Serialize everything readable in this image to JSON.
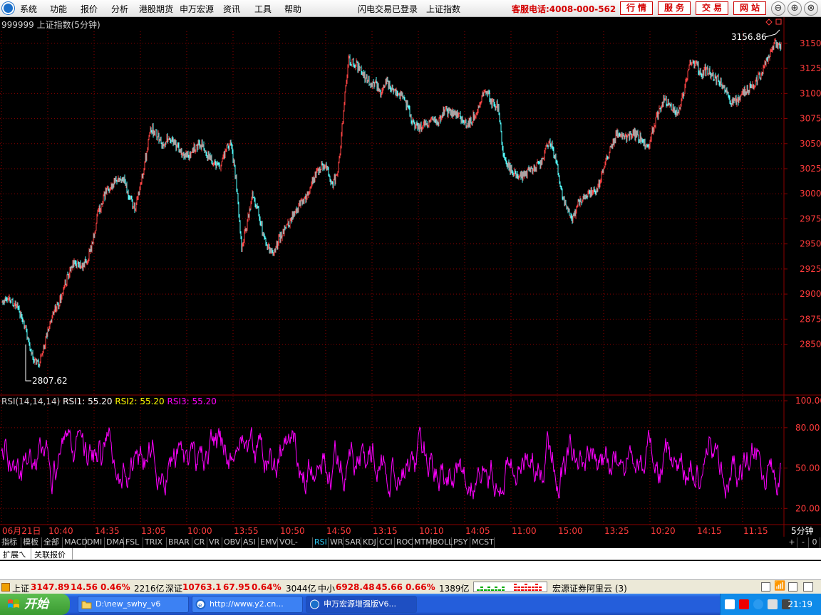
{
  "menubar": {
    "items": [
      "系统",
      "功能",
      "报价",
      "分析",
      "港股期货",
      "申万宏源",
      "资讯",
      "工具",
      "帮助"
    ],
    "status": "闪电交易已登录",
    "index_name": "上证指数",
    "hotline": "客服电话:4008-000-562",
    "buttons": [
      "行情",
      "服务",
      "交易",
      "网站"
    ],
    "window_controls": [
      "⊖",
      "⊕",
      "⊗"
    ]
  },
  "chart_header": {
    "title": "999999 上证指数(5分钟)"
  },
  "colors": {
    "up_candle": "#ff4444",
    "down_candle": "#54ffff",
    "rsi_line": "#ff00ff",
    "rsi1": "#ffffff",
    "rsi2": "#ffff00",
    "rsi3": "#ff00ff",
    "grid": "#8b0000",
    "axis_text": "#ff3b3b"
  },
  "chart_data": [
    {
      "type": "line",
      "series": [
        {
          "values": [
            2890,
            2898,
            2893,
            2885,
            2875,
            2855,
            2835,
            2830,
            2848,
            2870,
            2885,
            2895,
            2912,
            2925,
            2932,
            2926,
            2934,
            2950,
            2978,
            2995,
            3005,
            3010,
            3015,
            3012,
            2995,
            2985,
            3010,
            3035,
            3065,
            3060,
            3050,
            3055,
            3052,
            3046,
            3040,
            3038,
            3045,
            3050,
            3046,
            3035,
            3030,
            3025,
            3045,
            3050,
            3010,
            2945,
            2970,
            2998,
            2985,
            2960,
            2945,
            2940,
            2955,
            2965,
            2970,
            2985,
            2990,
            2995,
            3010,
            3020,
            3030,
            3025,
            3010,
            3020,
            3080,
            3135,
            3130,
            3125,
            3118,
            3110,
            3112,
            3100,
            3112,
            3105,
            3102,
            3098,
            3088,
            3070,
            3065,
            3070,
            3068,
            3075,
            3072,
            3085,
            3080,
            3080,
            3075,
            3070,
            3072,
            3085,
            3097,
            3100,
            3090,
            3088,
            3035,
            3028,
            3020,
            3015,
            3020,
            3025,
            3027,
            3030,
            3045,
            3050,
            3030,
            3000,
            2985,
            2975,
            2990,
            2995,
            3000,
            3002,
            3010,
            3030,
            3045,
            3058,
            3060,
            3055,
            3060,
            3058,
            3055,
            3045,
            3065,
            3080,
            3095,
            3090,
            3080,
            3085,
            3105,
            3132,
            3130,
            3120,
            3125,
            3118,
            3115,
            3110,
            3098,
            3090,
            3095,
            3102,
            3105,
            3110,
            3118,
            3130,
            3140,
            3152,
            3148
          ],
          "min_label": 2807.62,
          "max_label": 3156.86
        }
      ],
      "y_ticks": [
        3150,
        3125,
        3100,
        3075,
        3050,
        3025,
        3000,
        2975,
        2950,
        2925,
        2900,
        2875,
        2850
      ],
      "ylim": [
        2800,
        3162
      ],
      "x_tick_labels": [
        "06月21日",
        "10:40",
        "14:35",
        "13:05",
        "10:00",
        "13:55",
        "10:50",
        "14:50",
        "13:15",
        "10:10",
        "14:05",
        "11:00",
        "15:00",
        "13:25",
        "10:20",
        "14:15",
        "11:15"
      ]
    },
    {
      "type": "line",
      "title": "RSI(14,14,14)",
      "series": [
        {
          "name": "RSI1",
          "value": 55.2
        },
        {
          "name": "RSI2",
          "value": 55.2
        },
        {
          "name": "RSI3",
          "value": 55.2
        }
      ],
      "y_ticks": [
        100.0,
        80.0,
        50.0,
        20.0
      ],
      "ylim": [
        8,
        100
      ],
      "period_label": "5分钟"
    }
  ],
  "tabs": {
    "items": [
      "指标",
      "模板",
      "全部",
      "MACD",
      "DMI",
      "DMA",
      "FSL",
      "TRIX",
      "BRAR",
      "CR",
      "VR",
      "OBV",
      "ASI",
      "EMV",
      "VOL-TDX",
      "RSI",
      "WR",
      "SAR",
      "KDJ",
      "CCI",
      "ROC",
      "MTM",
      "BOLL",
      "PSY",
      "MCST"
    ],
    "active": "RSI",
    "controls": [
      "+",
      "-",
      "0"
    ]
  },
  "ext_bar": {
    "items": [
      "扩展ㄟ",
      "关联报价"
    ]
  },
  "quote_bar": {
    "sh_label": "上证",
    "sh_value": "3147.89",
    "sh_change": "14.56",
    "sh_pct": "0.46%",
    "sh_amount": "2216亿",
    "sz_label": "深证",
    "sz_value": "10763.1",
    "sz_change": "67.95",
    "sz_pct": "0.64%",
    "sz_amount": "3044亿",
    "zx_label": "中小",
    "zx_value": "6928.48",
    "zx_change": "45.66",
    "zx_pct": "0.66%",
    "zx_amount": "1389亿",
    "broker": "宏源证券阿里云 (3)"
  },
  "taskbar": {
    "start": "开始",
    "tasks": [
      "D:\\new_swhy_v6",
      "http://www.y2.cn...",
      "申万宏源增强版V6..."
    ],
    "clock": "21:19"
  }
}
